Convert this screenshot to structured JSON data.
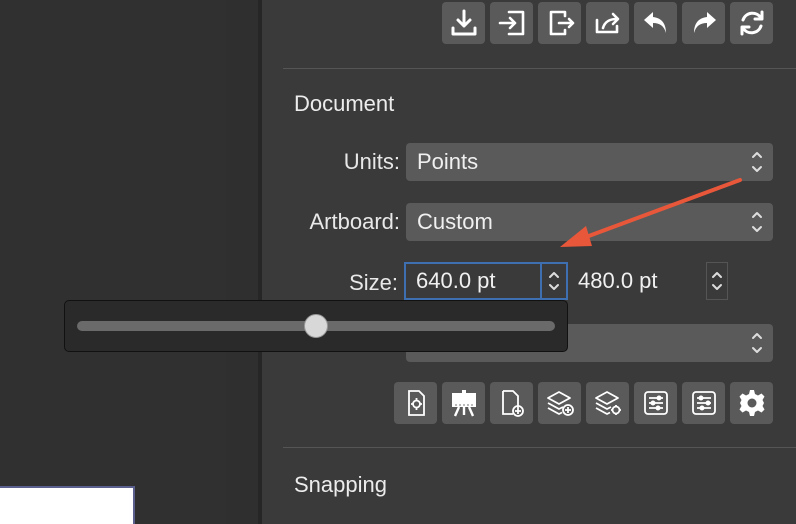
{
  "toolbar": {
    "buttons": [
      "import-icon",
      "open-in-icon",
      "export-file-icon",
      "share-icon",
      "undo-icon",
      "redo-icon",
      "reload-icon"
    ]
  },
  "document": {
    "title": "Document",
    "units_label": "Units:",
    "units_value": "Points",
    "artboard_label": "Artboard:",
    "artboard_value": "Custom",
    "size_label": "Size:",
    "width_value": "640.0 pt",
    "height_value": "480.0 pt",
    "icon_buttons": [
      "document-settings-icon",
      "artboard-easel-icon",
      "add-page-icon",
      "add-layer-icon",
      "layer-settings-icon",
      "align-sliders-icon",
      "distribute-sliders-icon",
      "gear-icon"
    ]
  },
  "snapping": {
    "title": "Snapping"
  },
  "slider_popup": {
    "value_fraction": 0.5
  },
  "colors": {
    "annotation_arrow": "#e8573a",
    "focus_ring": "#3e6fb0"
  }
}
